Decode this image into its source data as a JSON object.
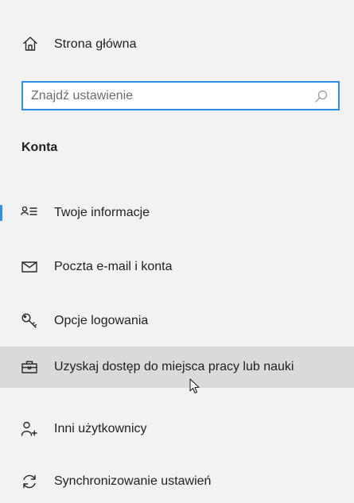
{
  "sidebar": {
    "home": {
      "label": "Strona główna",
      "icon": "home-icon"
    },
    "search": {
      "placeholder": "Znajdź ustawienie",
      "value": "",
      "icon": "search-icon"
    },
    "section_title": "Konta",
    "items": [
      {
        "label": "Twoje informacje",
        "icon": "user-info-icon",
        "selected": true
      },
      {
        "label": "Poczta e-mail i konta",
        "icon": "mail-icon",
        "selected": false
      },
      {
        "label": "Opcje logowania",
        "icon": "key-icon",
        "selected": false
      },
      {
        "label": "Uzyskaj dostęp do miejsca pracy lub nauki",
        "icon": "briefcase-icon",
        "selected": false,
        "hovered": true
      },
      {
        "label": "Inni użytkownicy",
        "icon": "add-user-icon",
        "selected": false
      },
      {
        "label": "Synchronizowanie ustawień",
        "icon": "sync-icon",
        "selected": false
      }
    ]
  },
  "colors": {
    "background": "#f2f2f2",
    "accent": "#2d8fe7",
    "hover": "#dadada",
    "text": "#1f1f1f"
  }
}
